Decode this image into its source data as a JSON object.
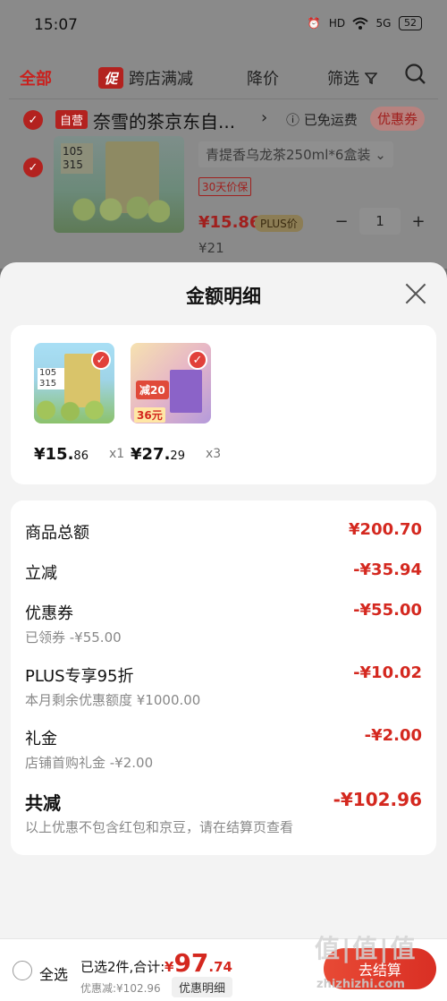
{
  "status_bar": {
    "time": "15:07",
    "battery": "52",
    "hd": "HD",
    "signal": "5G"
  },
  "filter_bar": {
    "all": "全部",
    "promo_badge": "促",
    "promo": "跨店满减",
    "price_drop": "降价",
    "filter": "筛选"
  },
  "shop": {
    "self_tag": "自营",
    "name": "奈雪的茶京东自...",
    "free_shipping": "已免运费",
    "coupon": "优惠券"
  },
  "item": {
    "spec": "青提香乌龙茶250ml*6盒装 ⌄",
    "guarantee": "30天价保",
    "price": "¥15.86",
    "plus_tag": "PLUS价",
    "qty": "1",
    "old_price": "¥21",
    "img_label_1": "105",
    "img_label_2": "315"
  },
  "sheet": {
    "title": "金额明细",
    "products": [
      {
        "price_int": "¥15.",
        "price_dec": "86",
        "qty": "x1",
        "label_a": "105",
        "label_b": "315"
      },
      {
        "price_int": "¥27.",
        "price_dec": "29",
        "qty": "x3",
        "badge_a": "减20",
        "badge_b": "36元"
      }
    ],
    "details": {
      "total_label": "商品总额",
      "total_value": "¥200.70",
      "instant_label": "立减",
      "instant_value": "-¥35.94",
      "coupon_label": "优惠券",
      "coupon_value": "-¥55.00",
      "coupon_sub": "已领券 -¥55.00",
      "plus_label": "PLUS专享95折",
      "plus_value": "-¥10.02",
      "plus_sub": "本月剩余优惠额度 ¥1000.00",
      "gift_label": "礼金",
      "gift_value": "-¥2.00",
      "gift_sub": "店铺首购礼金 -¥2.00",
      "sum_label": "共减",
      "sum_value": "-¥102.96",
      "sum_sub": "以上优惠不包含红包和京豆，请在结算页查看"
    }
  },
  "bottom_bar": {
    "select_all": "全选",
    "selected": "已选2件,合计:",
    "currency": "¥",
    "total_int": "97",
    "total_dec": ".74",
    "discount": "优惠减:¥102.96",
    "detail_button": "优惠明细",
    "checkout": "去结算"
  },
  "watermark": {
    "text": "值|值|值",
    "url": "zhizhizhi.com"
  },
  "colors": {
    "accent": "#d4281f",
    "sheet_bg": "#f3f3f3",
    "overlay": "#8a8a8a"
  }
}
